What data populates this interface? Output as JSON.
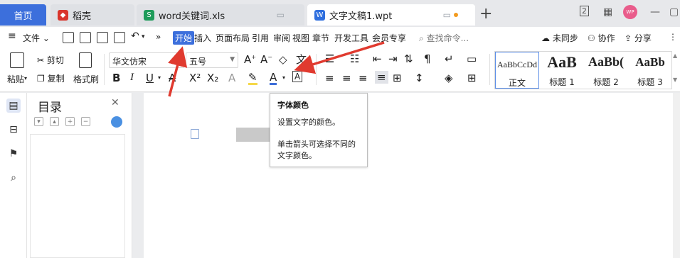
{
  "tabs": [
    {
      "label": "首页"
    },
    {
      "label": "稻壳",
      "icon": "docer-icon",
      "color": "#d9342b"
    },
    {
      "label": "word关键词.xls",
      "icon": "excel-icon",
      "color": "#1e9b5a"
    },
    {
      "label": "文字文稿1.wpt",
      "icon": "writer-icon",
      "color": "#2f6fde"
    }
  ],
  "titlebar": {
    "avatar": "WP",
    "page_badge": "2"
  },
  "menu": {
    "file": "文件",
    "items": [
      "开始",
      "插入",
      "页面布局",
      "引用",
      "审阅",
      "视图",
      "章节",
      "开发工具",
      "会员专享"
    ],
    "active": "开始",
    "search_placeholder": "查找命令...",
    "sync": "未同步",
    "collab": "协作",
    "share": "分享"
  },
  "ribbon": {
    "paste": "粘贴",
    "cut": "剪切",
    "copy": "复制",
    "format_painter": "格式刷",
    "font_name": "华文仿宋",
    "font_size": "五号",
    "styles": [
      {
        "sample": "AaBbCcDd",
        "name": "正文"
      },
      {
        "sample": "AaB",
        "name": "标题 1"
      },
      {
        "sample": "AaBb(",
        "name": "标题 2"
      },
      {
        "sample": "AaBb",
        "name": "标题 3"
      }
    ]
  },
  "nav": {
    "title": "目录"
  },
  "tooltip": {
    "title": "字体颜色",
    "desc": "设置文字的颜色。",
    "hint": "单击箭头可选择不同的文字颜色。"
  },
  "colors": {
    "accent": "#3c6fdc",
    "arrow": "#e03a2f",
    "highlight": "#f5d84a",
    "font_color_bar": "#3e6fd9"
  }
}
